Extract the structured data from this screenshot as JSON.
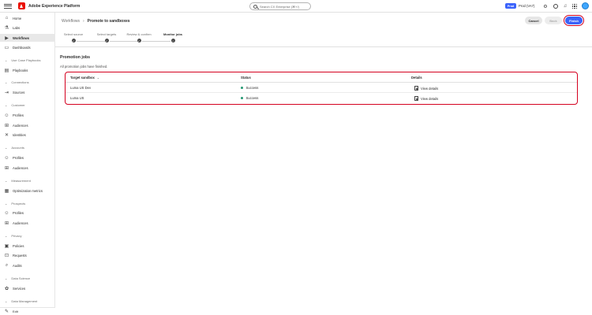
{
  "app": {
    "title": "Adobe Experience Platform",
    "search_placeholder": "Search CX Enterprise (⌘+/)",
    "environment_badge": "Prod",
    "environment_name": "Prod (VA7)"
  },
  "sidebar": {
    "items": [
      {
        "key": "home",
        "label": "Home",
        "icon": "home-icon"
      },
      {
        "key": "labs",
        "label": "Labs",
        "icon": "flask-icon"
      },
      {
        "key": "workflows",
        "label": "Workflows",
        "icon": "workflow-icon",
        "active": true
      },
      {
        "key": "dashboards",
        "label": "Dashboards",
        "icon": "dashboard-icon"
      }
    ],
    "sections": {
      "use_case_playbooks": {
        "label": "Use Case Playbooks",
        "items": [
          {
            "label": "Playbooks",
            "icon": "playbook-icon"
          }
        ]
      },
      "connections": {
        "label": "Connections",
        "items": [
          {
            "label": "Sources",
            "icon": "sources-icon"
          }
        ]
      },
      "customer": {
        "label": "Customer",
        "items": [
          {
            "label": "Profiles",
            "icon": "profile-icon"
          },
          {
            "label": "Audiences",
            "icon": "audiences-icon"
          },
          {
            "label": "Identities",
            "icon": "identities-icon"
          }
        ]
      },
      "accounts": {
        "label": "Accounts",
        "items": [
          {
            "label": "Profiles",
            "icon": "profile-icon"
          },
          {
            "label": "Audiences",
            "icon": "audiences-icon"
          }
        ]
      },
      "measurement": {
        "label": "Measurement",
        "items": [
          {
            "label": "Optimization metrics",
            "icon": "metrics-icon"
          }
        ]
      },
      "prospects": {
        "label": "Prospects",
        "items": [
          {
            "label": "Profiles",
            "icon": "profile-icon"
          },
          {
            "label": "Audiences",
            "icon": "audiences-icon"
          }
        ]
      },
      "privacy": {
        "label": "Privacy",
        "items": [
          {
            "label": "Policies",
            "icon": "policy-icon"
          },
          {
            "label": "Requests",
            "icon": "requests-icon"
          },
          {
            "label": "Audits",
            "icon": "audits-icon"
          }
        ]
      },
      "data_science": {
        "label": "Data Science",
        "items": [
          {
            "label": "Services",
            "icon": "services-icon"
          }
        ]
      },
      "data_management": {
        "label": "Data Management"
      }
    },
    "footer_label": "Edit"
  },
  "header": {
    "breadcrumb_parent": "Workflows",
    "breadcrumb_current": "Promote to sandboxes",
    "cancel_label": "Cancel",
    "back_label": "Back",
    "finish_label": "Finish"
  },
  "stepper": {
    "steps": [
      {
        "label": "Select source",
        "state": "done"
      },
      {
        "label": "Select targets",
        "state": "done"
      },
      {
        "label": "Review & confirm",
        "state": "done"
      },
      {
        "label": "Monitor jobs",
        "state": "current"
      }
    ]
  },
  "jobs": {
    "title": "Promotion jobs",
    "message": "All promotion jobs have finished.",
    "columns": {
      "target": "Target sandbox",
      "status": "Status",
      "details": "Details"
    },
    "rows": [
      {
        "target": "Luma US Dev",
        "status": "Success",
        "details": "View details"
      },
      {
        "target": "Luma US",
        "status": "Success",
        "details": "View details"
      }
    ]
  },
  "colors": {
    "accent": "#3b63fb",
    "highlight": "#d4001f",
    "success": "#2d9d78"
  }
}
